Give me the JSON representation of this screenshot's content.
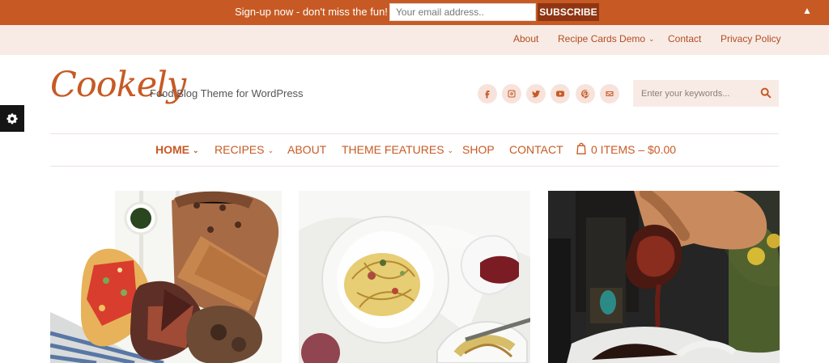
{
  "colors": {
    "accent": "#c75a24",
    "dark_accent": "#8f3512",
    "light_background": "#f8ebe6"
  },
  "promo": {
    "text": "Sign-up now - don't miss the fun!",
    "email_placeholder": "Your email address..",
    "button": "SUBSCRIBE",
    "toggle_icon": "▲"
  },
  "top_nav": [
    {
      "label": "About",
      "icon": ""
    },
    {
      "label": "Recipe Cards Demo",
      "icon": "chevron-down"
    },
    {
      "label": "Contact",
      "icon": ""
    },
    {
      "label": "Privacy Policy",
      "icon": ""
    }
  ],
  "brand": {
    "logo": "Cookely",
    "tagline": "Food Blog Theme for WordPress"
  },
  "social": [
    "facebook-icon",
    "instagram-icon",
    "twitter-icon",
    "youtube-icon",
    "pinterest-icon",
    "email-icon"
  ],
  "search": {
    "placeholder": "Enter your keywords...",
    "icon": "search-icon"
  },
  "main_nav": [
    {
      "label": "HOME",
      "dropdown": true,
      "active": true
    },
    {
      "label": "RECIPES",
      "dropdown": true,
      "active": false
    },
    {
      "label": "ABOUT",
      "dropdown": false,
      "active": false
    },
    {
      "label": "THEME FEATURES",
      "dropdown": true,
      "active": false
    },
    {
      "label": "SHOP",
      "dropdown": false,
      "active": false
    },
    {
      "label": "CONTACT",
      "dropdown": false,
      "active": false
    }
  ],
  "cart": {
    "text": "0 ITEMS – $0.00",
    "icon": "shopping-bag-icon"
  },
  "settings_icon": "gear-icon",
  "cards": [
    {
      "image": "bruschetta-and-bread-photo"
    },
    {
      "image": "spaghetti-and-wine-photo"
    },
    {
      "image": "sauce-pouring-photo"
    }
  ]
}
